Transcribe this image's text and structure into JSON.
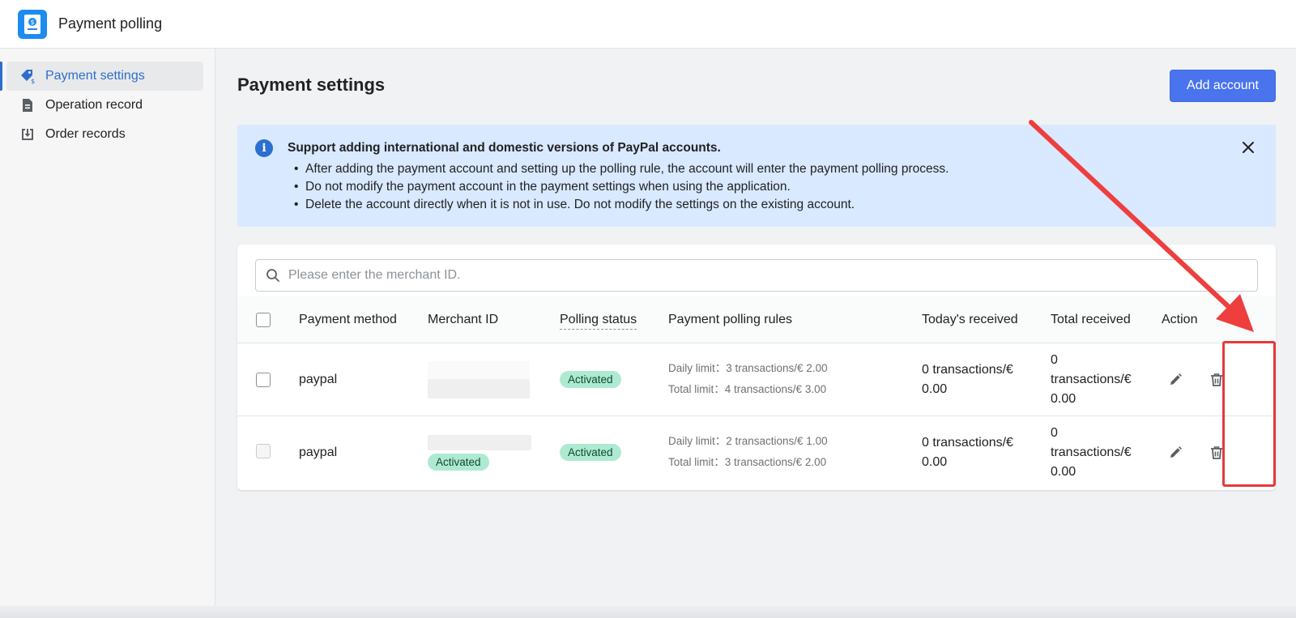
{
  "app": {
    "title": "Payment polling",
    "logo_icon": "payment-app-logo"
  },
  "sidebar": {
    "items": [
      {
        "label": "Payment settings",
        "icon": "payment-tag-icon",
        "active": true
      },
      {
        "label": "Operation record",
        "icon": "document-icon",
        "active": false
      },
      {
        "label": "Order records",
        "icon": "download-tray-icon",
        "active": false
      }
    ]
  },
  "page": {
    "title": "Payment settings",
    "add_button": "Add account"
  },
  "banner": {
    "title": "Support adding international and domestic versions of PayPal accounts.",
    "bullets": [
      "After adding the payment account and setting up the polling rule, the account will enter the payment polling process.",
      "Do not modify the payment account in the payment settings when using the application.",
      "Delete the account directly when it is not in use. Do not modify the settings on the existing account."
    ],
    "bg_color": "#d9e9ff"
  },
  "search": {
    "placeholder": "Please enter the merchant ID.",
    "value": ""
  },
  "table": {
    "headers": {
      "method": "Payment method",
      "merchant": "Merchant ID",
      "status": "Polling status",
      "rules": "Payment polling rules",
      "today": "Today's received",
      "total": "Total received",
      "action": "Action"
    },
    "rows": [
      {
        "method": "paypal",
        "merchant_badge": "",
        "status": "Activated",
        "daily_rule": "Daily limit：3 transactions/€ 2.00",
        "total_rule": "Total limit：4 transactions/€ 3.00",
        "today_1": "0 transactions/€",
        "today_2": "0.00",
        "total_1": "0",
        "total_2": "transactions/€",
        "total_3": "0.00"
      },
      {
        "method": "paypal",
        "merchant_badge": "Activated",
        "status": "Activated",
        "daily_rule": "Daily limit：2 transactions/€ 1.00",
        "total_rule": "Total limit：3 transactions/€ 2.00",
        "today_1": "0 transactions/€",
        "today_2": "0.00",
        "total_1": "0",
        "total_2": "transactions/€",
        "total_3": "0.00"
      }
    ]
  },
  "colors": {
    "primary": "#4a74ee",
    "active_nav": "#2c6ecb",
    "badge_bg": "#aee9d1",
    "annotation": "#e33b3b"
  }
}
